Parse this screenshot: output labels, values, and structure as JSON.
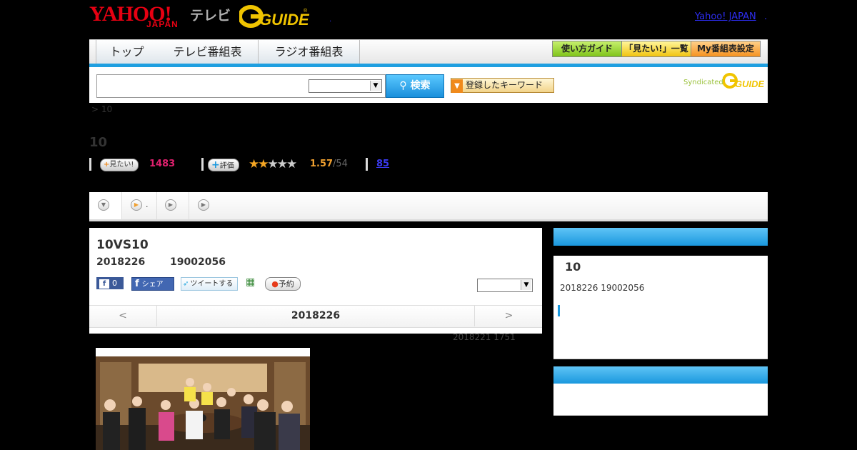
{
  "header": {
    "logo_yahoo": "YAHOO!",
    "logo_japan": "JAPAN",
    "logo_tv": "テレビ",
    "logo_gguide": "G-GUIDE",
    "link_yahoo_japan": "Yahoo! JAPAN",
    "separator": ".",
    "separator_small": "."
  },
  "nav": {
    "tabs": [
      {
        "label": "トップ"
      },
      {
        "label": "テレビ番組表"
      },
      {
        "label": "ラジオ番組表"
      }
    ],
    "buttons": [
      {
        "label": "使い方ガイド"
      },
      {
        "label": "「見たい!」一覧"
      },
      {
        "label": "My番組表設定"
      }
    ]
  },
  "search": {
    "input_value": "",
    "select_value": "",
    "button_label": "検索",
    "keyword_button_label": "登録したキーワード",
    "syndicated_label": "Syndicated",
    "syndicated_logo": "GUIDE"
  },
  "breadcrumb": "> 10",
  "program": {
    "title": "10",
    "want_label": "見たい!",
    "want_count": "1483",
    "rate_label": "評価",
    "rating": "1.57",
    "rating_total": "/54",
    "review_count": "85",
    "subtab_2_label": "."
  },
  "episode": {
    "title": "10VS10",
    "date": "2018226",
    "time": "19002056",
    "fb_like_count": "0",
    "fb_share_label": "シェア",
    "tweet_label": "ツイートする",
    "reserve_label": "予約",
    "select_value": "",
    "prev_label": "<",
    "next_label": ">",
    "current_date": "2018226",
    "updated": "2018221  1751"
  },
  "sidebar": {
    "title": "10",
    "info": "2018226  19002056"
  },
  "colors": {
    "accent_blue": "#1a98de",
    "want_pink": "#e0206e",
    "star_orange": "#f5a623",
    "yahoo_red": "#e60012"
  }
}
